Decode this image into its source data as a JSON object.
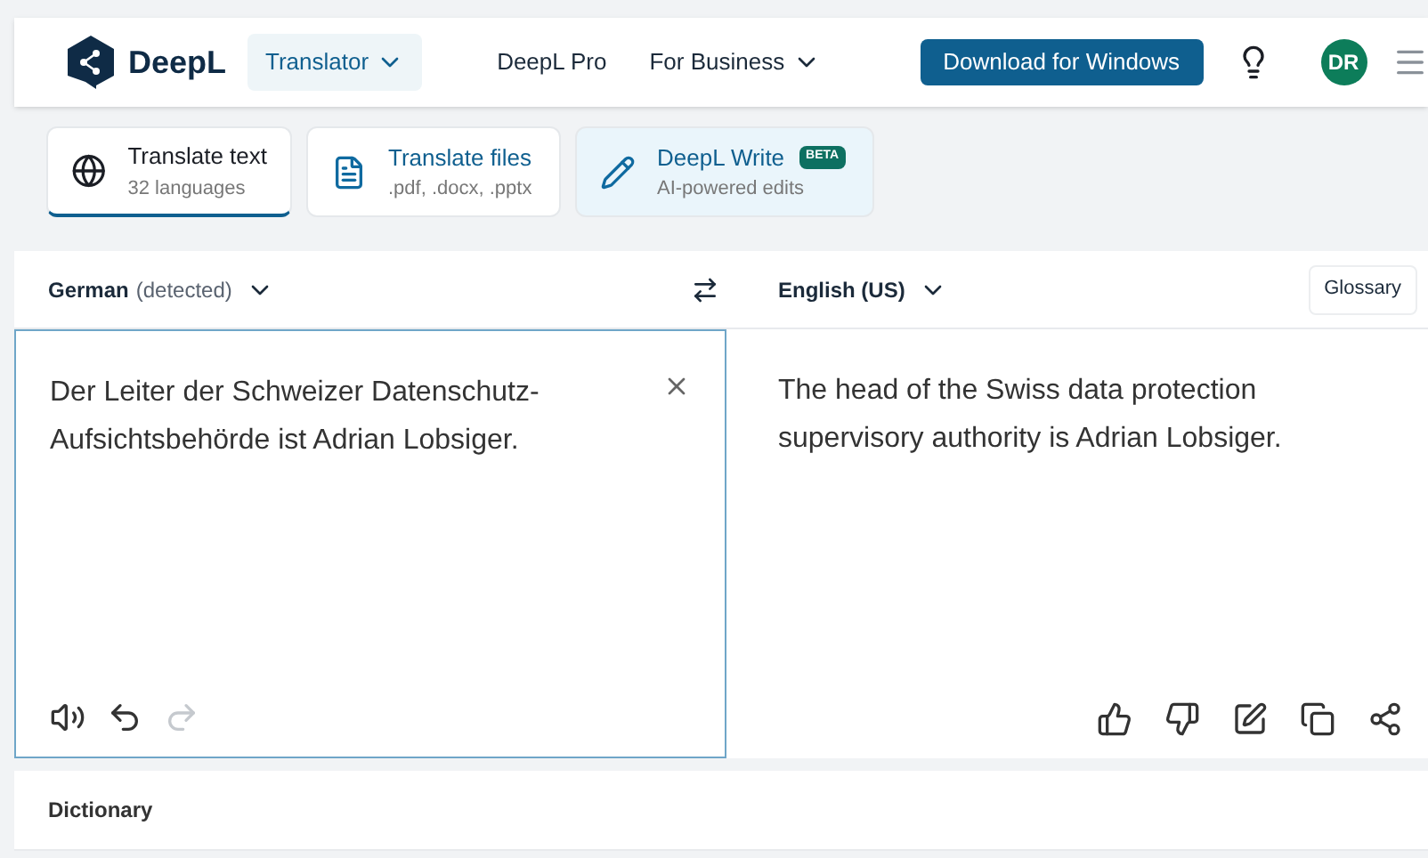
{
  "nav": {
    "logo": "DeepL",
    "translator": "Translator",
    "links": [
      {
        "label": "DeepL Pro",
        "dropdown": false
      },
      {
        "label": "For Business",
        "dropdown": true
      }
    ],
    "download": "Download for Windows",
    "avatar": "DR"
  },
  "tabs": [
    {
      "kind": "text",
      "title": "Translate text",
      "subtitle": "32 languages",
      "selected": true
    },
    {
      "kind": "files",
      "title": "Translate files",
      "subtitle": ".pdf, .docx, .pptx",
      "selected": false
    },
    {
      "kind": "write",
      "title": "DeepL Write",
      "badge": "BETA",
      "subtitle": "AI-powered edits",
      "selected": false
    }
  ],
  "source": {
    "language": "German",
    "note": "(detected)",
    "text": "Der Leiter der Schweizer Datenschutz-Aufsichtsbehörde ist Adrian Lobsiger.",
    "redo_disabled": true
  },
  "target": {
    "language": "English (US)",
    "glossary": "Glossary",
    "text": "The head of the Swiss data protection supervisory authority is Adrian Lobsiger."
  },
  "dictionary": {
    "title": "Dictionary"
  }
}
